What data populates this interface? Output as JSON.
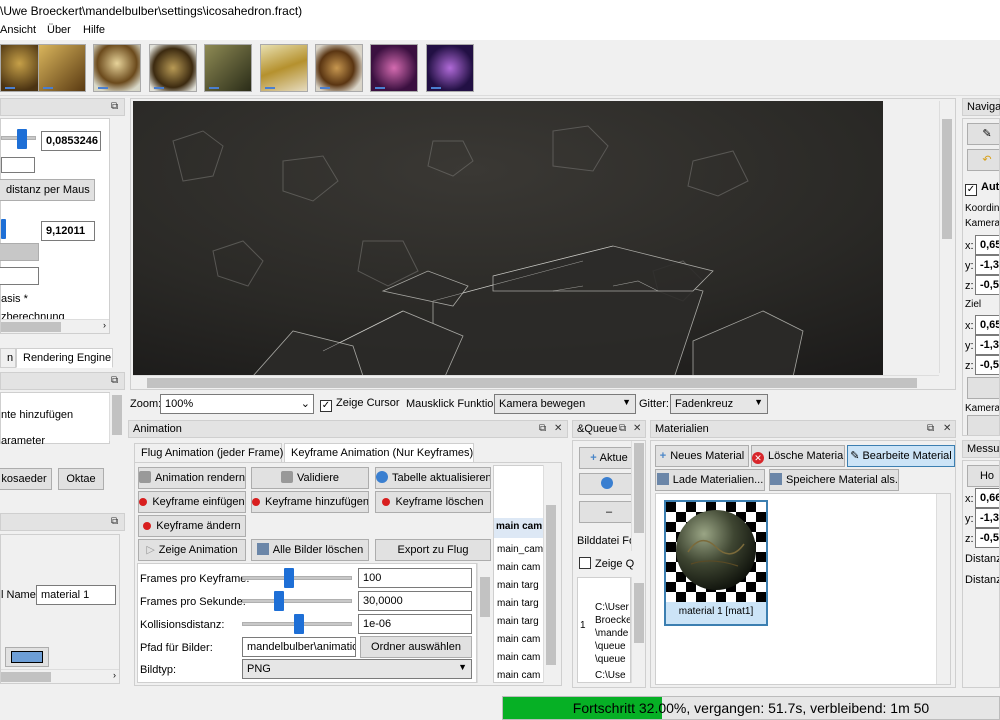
{
  "window": {
    "title": "\\Uwe Broeckert\\mandelbulber\\settings\\icosahedron.fract)"
  },
  "menu": [
    "Ansicht",
    "Über",
    "Hilfe"
  ],
  "left": {
    "top_panel": {
      "value1": "0,0853246",
      "button_distance": "distanz per Maus",
      "value2": "9,12011",
      "text_basis": "asis *",
      "text_berechnung": "zberechnung"
    },
    "tabs": [
      "n",
      "Rendering Engine"
    ],
    "panel2": {
      "item1": "nte hinzufügen",
      "item2": "arameter",
      "btn1": "kosaeder",
      "btn2": "Oktae"
    },
    "panel3": {
      "name_label": "l Name:",
      "name_value": "material 1"
    }
  },
  "viewer": {
    "zoom_label": "Zoom:",
    "zoom_value": "100%",
    "show_cursor": "Zeige Cursor",
    "click_label": "Mausklick Funktion:",
    "click_value": "Kamera bewegen",
    "grid_label": "Gitter:",
    "grid_value": "Fadenkreuz"
  },
  "animation": {
    "title": "Animation",
    "tabs": [
      "Flug Animation (jeder Frame)",
      "Keyframe Animation (Nur Keyframes)"
    ],
    "buttons": {
      "render": "Animation rendern",
      "validate": "Validiere",
      "refresh_table": "Tabelle aktualisieren",
      "insert_keyframe": "Keyframe einfügen",
      "add_keyframe": "Keyframe hinzufügen",
      "delete_keyframe": "Keyframe löschen",
      "change_keyframe": "Keyframe ändern",
      "show_animation": "Zeige Animation",
      "delete_images": "Alle Bilder löschen",
      "export_flight": "Export zu Flug",
      "choose_folder": "Ordner auswählen"
    },
    "fields": {
      "frames_per_keyframe_label": "Frames pro Keyframe:",
      "frames_per_keyframe": "100",
      "frames_per_second_label": "Frames pro Sekunde:",
      "frames_per_second": "30,0000",
      "collision_label": "Kollisionsdistanz:",
      "collision": "1e-06",
      "path_label": "Pfad für Bilder:",
      "path": "mandelbulber\\animation\\",
      "type_label": "Bildtyp:",
      "type": "PNG"
    },
    "table_header": [
      "main",
      "cam"
    ],
    "table_rows": [
      "main_cam",
      "main cam",
      "main targ",
      "main targ",
      "main targ",
      "main cam",
      "main cam",
      "main cam"
    ]
  },
  "queue": {
    "title": "&Queue",
    "btn_update": "Aktue",
    "bilddatei": "Bilddatei Fo",
    "show": "Zeige Q",
    "list": [
      "C:\\User",
      "Broecke",
      "\\mande",
      "\\queue",
      "\\queue",
      "C:\\Use"
    ],
    "row_index": "1"
  },
  "materials": {
    "title": "Materialien",
    "new": "Neues Material",
    "delete": "Lösche Material",
    "edit": "Bearbeite Material",
    "load": "Lade Materialien...",
    "save": "Speichere Material als...",
    "item_caption": "material 1 [mat1]"
  },
  "navigation": {
    "title": "Navigat",
    "auto": "Aut",
    "coords": "Koordina",
    "camera": "Kamera",
    "cam_x": "0,65",
    "cam_y": "-1,3",
    "cam_z": "-0,5",
    "target": "Ziel",
    "tgt_x": "0,65",
    "tgt_y": "-1,3",
    "tgt_z": "-0,5",
    "camera_u": "Kamera u",
    "measure_title": "Messun",
    "ho": "Ho",
    "m_x": "0,66",
    "m_y": "-1,3",
    "m_z": "-0,5",
    "dist1": "Distanz",
    "dist2": "Distanz"
  },
  "status": {
    "progress_text": "Fortschritt 32.00%, vergangen: 51.7s, verbleibend: 1m 50",
    "progress": 0.32
  }
}
